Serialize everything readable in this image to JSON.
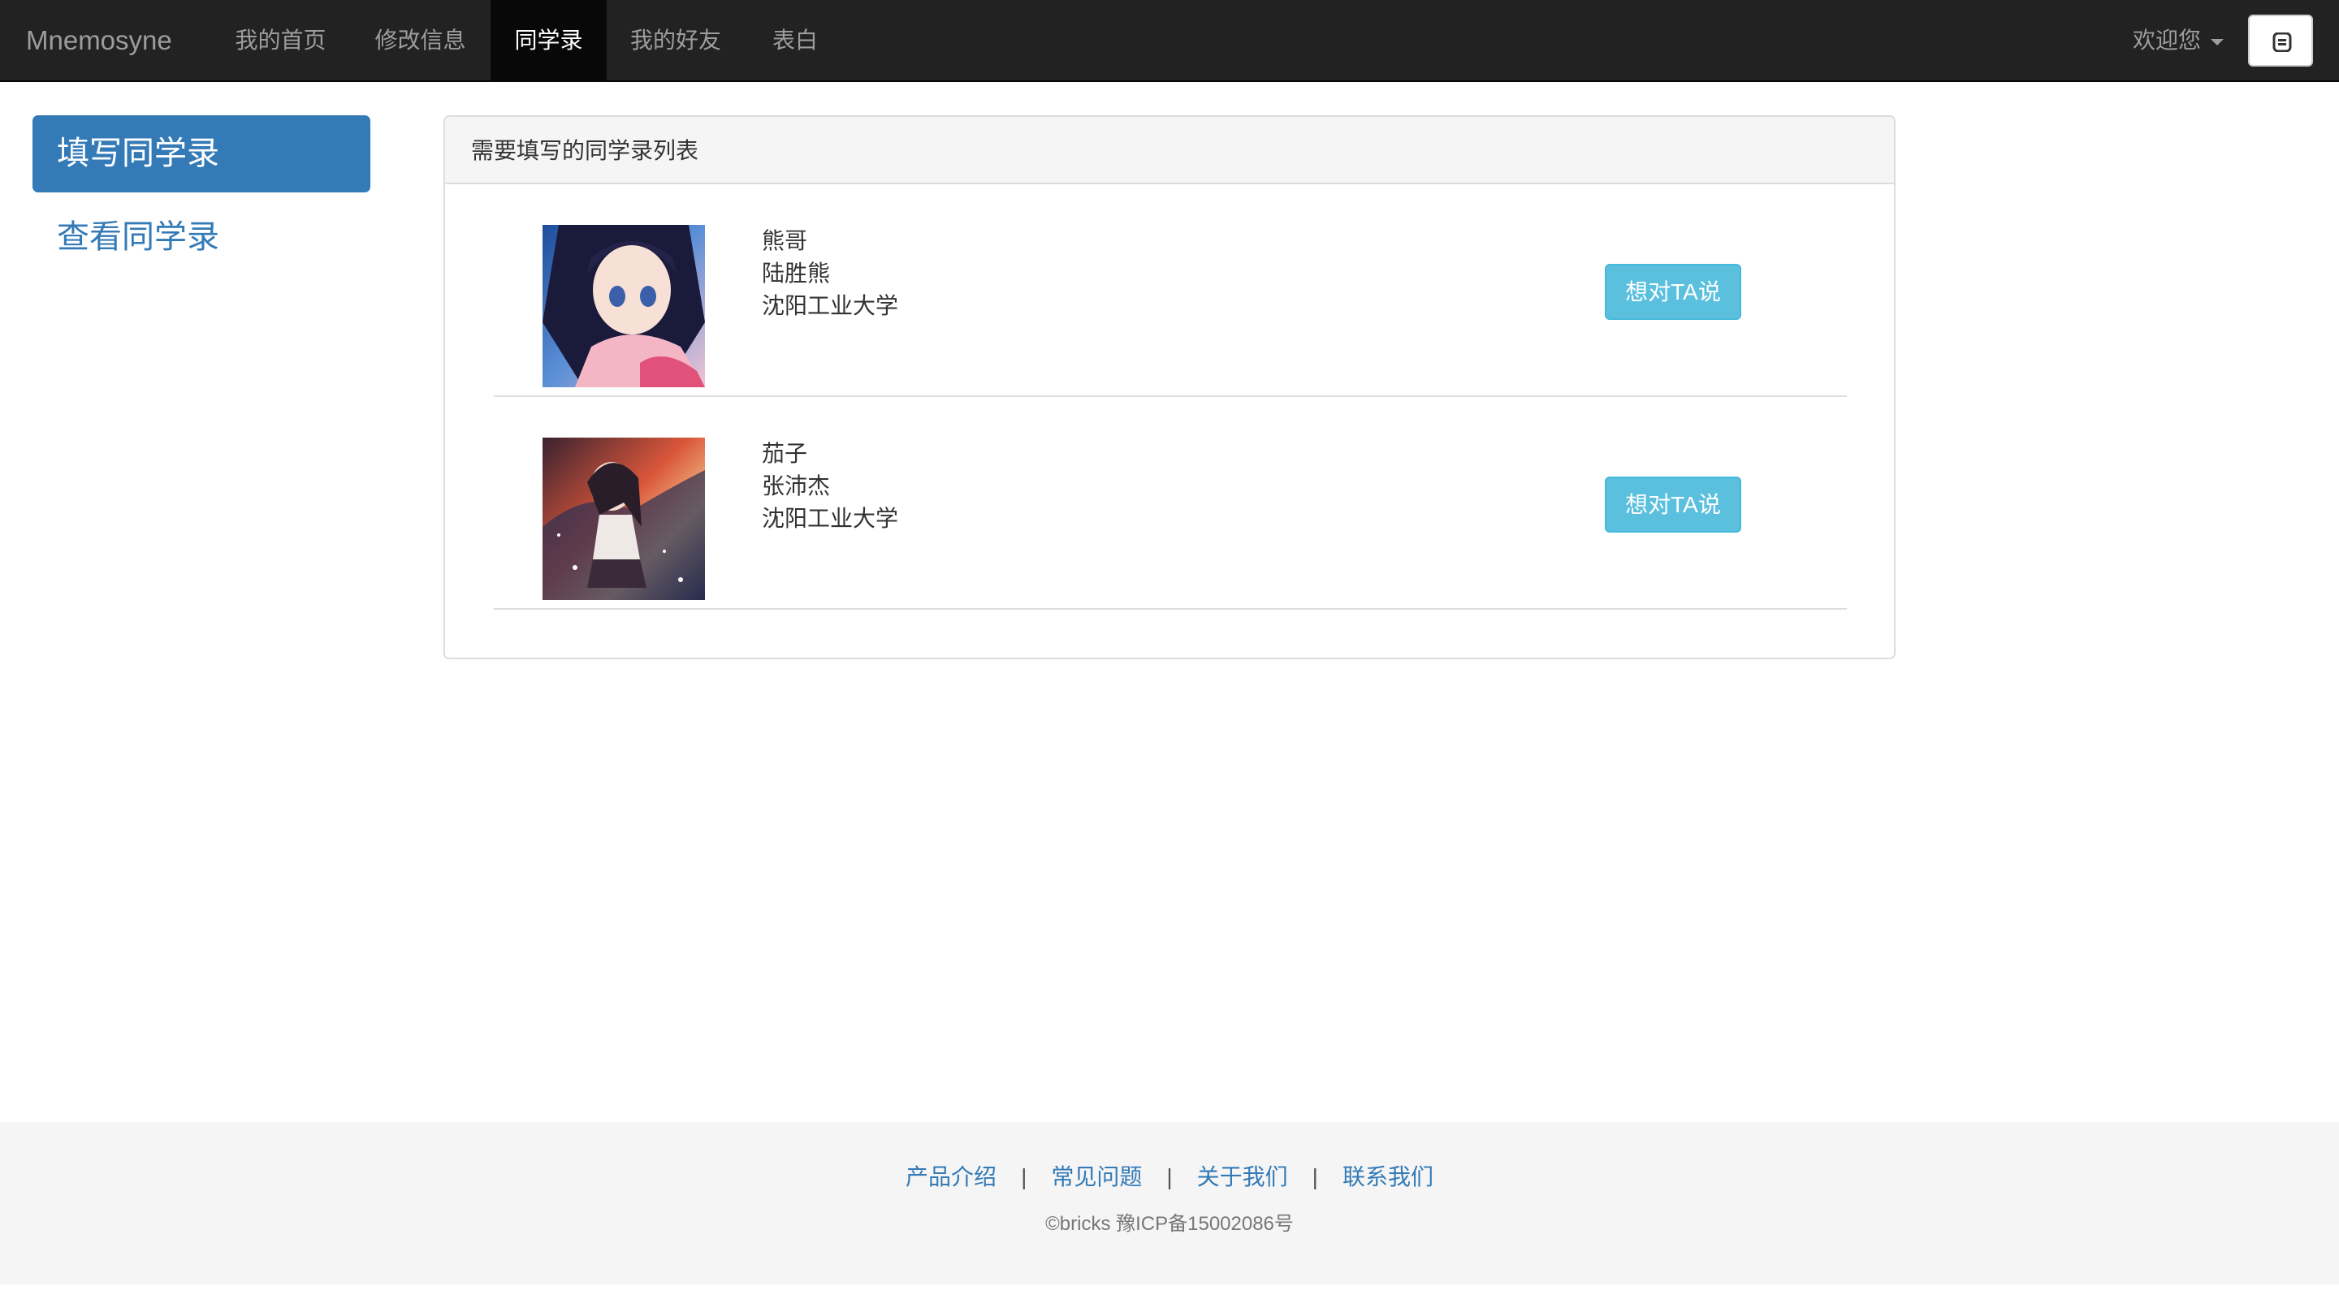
{
  "navbar": {
    "brand": "Mnemosyne",
    "items": [
      {
        "label": "我的首页",
        "active": false
      },
      {
        "label": "修改信息",
        "active": false
      },
      {
        "label": "同学录",
        "active": true
      },
      {
        "label": "我的好友",
        "active": false
      },
      {
        "label": "表白",
        "active": false
      }
    ],
    "welcome": "欢迎您",
    "toggle_icon": "bars-icon"
  },
  "sidebar": {
    "items": [
      {
        "label": "填写同学录",
        "active": true
      },
      {
        "label": "查看同学录",
        "active": false
      }
    ]
  },
  "panel": {
    "title": "需要填写的同学录列表",
    "entries": [
      {
        "nickname": "熊哥",
        "name": "陆胜熊",
        "school": "沈阳工业大学",
        "button": "想对TA说"
      },
      {
        "nickname": "茄子",
        "name": "张沛杰",
        "school": "沈阳工业大学",
        "button": "想对TA说"
      }
    ]
  },
  "footer": {
    "links": [
      "产品介绍",
      "常见问题",
      "关于我们",
      "联系我们"
    ],
    "separator": "|",
    "copyright": "©bricks 豫ICP备15002086号"
  },
  "colors": {
    "navbar_bg": "#222222",
    "primary": "#337ab7",
    "info_button": "#5bc0de",
    "footer_bg": "#f5f5f5"
  }
}
